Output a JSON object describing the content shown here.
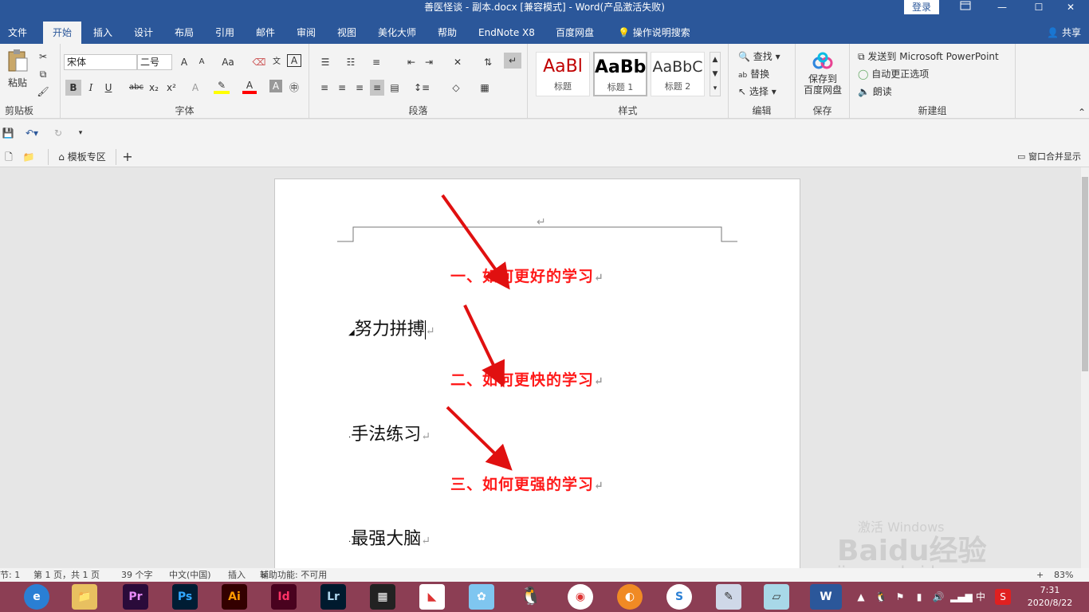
{
  "titlebar": {
    "title": "善医怪谈 - 副本.docx [兼容模式]  -  Word(产品激活失败)",
    "login": "登录",
    "restore_icon": "ribbon-display-icon",
    "minimize": "—",
    "maximize": "☐",
    "close": "✕"
  },
  "tabs": [
    "文件",
    "开始",
    "插入",
    "设计",
    "布局",
    "引用",
    "邮件",
    "审阅",
    "视图",
    "美化大师",
    "帮助",
    "EndNote X8",
    "百度网盘",
    "操作说明搜索"
  ],
  "share": "共享",
  "ribbon": {
    "clipboard": {
      "paste": "粘贴",
      "label": "剪贴板"
    },
    "font": {
      "name": "宋体",
      "size": "二号",
      "label": "字体",
      "bold": "B",
      "italic": "I",
      "underline": "U",
      "strike": "abc",
      "sub": "x₂",
      "sup": "x²",
      "grow": "A",
      "shrink": "A",
      "case": "Aa"
    },
    "paragraph": {
      "label": "段落"
    },
    "styles": {
      "label": "样式",
      "items": [
        {
          "sample": "AaBl",
          "name": "标题",
          "color": "#c00000"
        },
        {
          "sample": "AaBb",
          "name": "标题 1",
          "color": "#000000"
        },
        {
          "sample": "AaBbC",
          "name": "标题 2",
          "color": "#333333"
        }
      ]
    },
    "editing": {
      "find": "查找",
      "replace": "替换",
      "select": "选择",
      "label": "编辑"
    },
    "save": {
      "line1": "保存到",
      "line2": "百度网盘",
      "label": "保存"
    },
    "newgroup": {
      "ppt": "发送到 Microsoft PowerPoint",
      "autocorrect": "自动更正选项",
      "read": "朗读",
      "label": "新建组"
    }
  },
  "doctabs": {
    "template": "模板专区",
    "add": "+",
    "merge": "窗口合并显示"
  },
  "document": {
    "header_mark": "↵",
    "headings": [
      "一、如何更好的学习",
      "二、如何更快的学习",
      "三、如何更强的学习"
    ],
    "items": [
      "努力拼搏",
      "手法练习",
      "最强大脑"
    ],
    "para_mark": "↵"
  },
  "statusbar": {
    "section": "节: 1",
    "page": "第 1 页，共 1 页",
    "words": "39 个字",
    "language": "中文(中国)",
    "mode": "插入",
    "accessibility": "辅助功能: 不可用",
    "zoom": "83%",
    "zoom_plus": "+"
  },
  "taskbar": {
    "apps": [
      "Pr",
      "Ps",
      "Ai",
      "Id",
      "Lr"
    ],
    "time": "7:31",
    "date": "2020/8/22",
    "ime": "中"
  },
  "watermark": {
    "line1": "激活 Windows",
    "line2": "Baidu经验",
    "line3": "jingyan.baidu.com"
  }
}
